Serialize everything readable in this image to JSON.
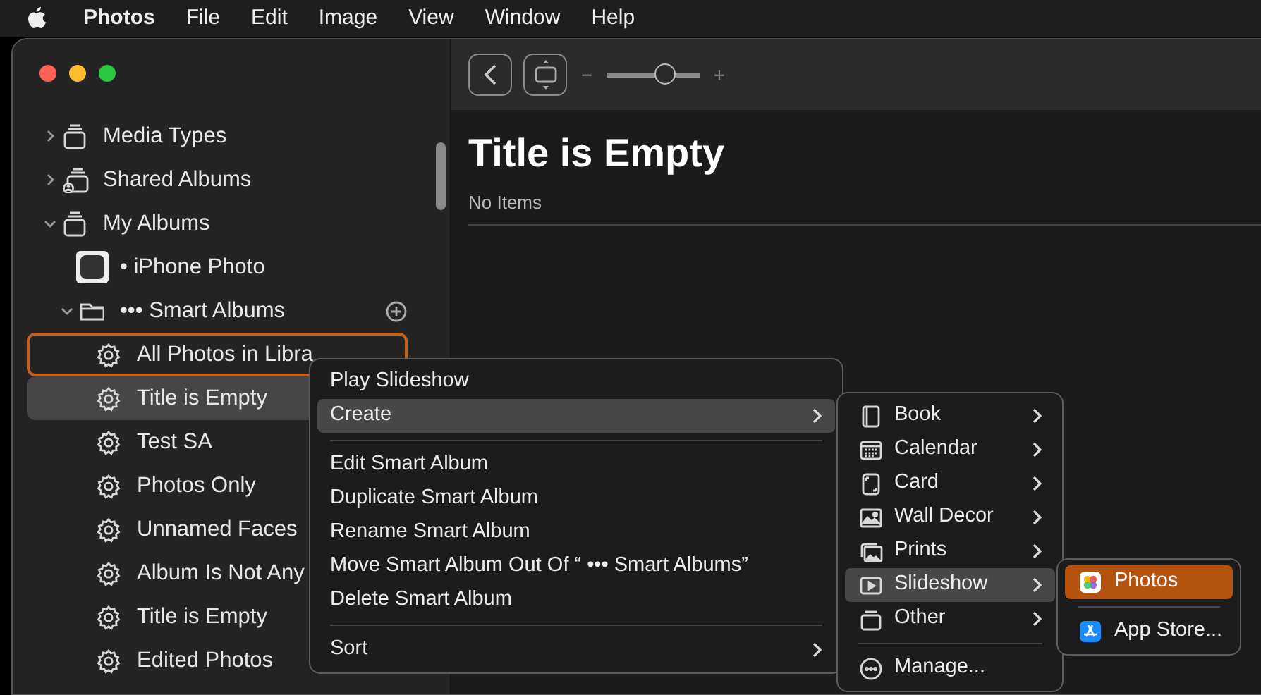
{
  "menu_bar": {
    "items": [
      {
        "label": "Photos",
        "kind": "app"
      },
      {
        "label": "File",
        "kind": "menu"
      },
      {
        "label": "Edit",
        "kind": "menu"
      },
      {
        "label": "Image",
        "kind": "menu"
      },
      {
        "label": "View",
        "kind": "menu"
      },
      {
        "label": "Window",
        "kind": "menu"
      },
      {
        "label": "Help",
        "kind": "menu"
      }
    ]
  },
  "sidebar": {
    "items": [
      {
        "label": "Media Types",
        "kind": "group",
        "expanded": false,
        "selected": false,
        "focused": false
      },
      {
        "label": "Shared Albums",
        "kind": "shared",
        "expanded": false,
        "selected": false,
        "focused": false
      },
      {
        "label": "My Albums",
        "kind": "group",
        "expanded": true,
        "selected": false,
        "focused": false,
        "children": [
          {
            "label": "• iPhone Photo",
            "kind": "album",
            "selected": false,
            "focused": false
          },
          {
            "label": "••• Smart Albums",
            "kind": "folder",
            "expanded": true,
            "selected": false,
            "focused": false,
            "children": [
              {
                "label": "All Photos in Libra",
                "kind": "smart",
                "selected": false,
                "focused": true
              },
              {
                "label": "Title is Empty",
                "kind": "smart",
                "selected": true,
                "focused": false
              },
              {
                "label": "Test SA",
                "kind": "smart",
                "selected": false,
                "focused": false
              },
              {
                "label": "Photos Only",
                "kind": "smart",
                "selected": false,
                "focused": false
              },
              {
                "label": "Unnamed Faces",
                "kind": "smart",
                "selected": false,
                "focused": false
              },
              {
                "label": "Album Is Not Any",
                "kind": "smart",
                "selected": false,
                "focused": false
              },
              {
                "label": "Title is Empty",
                "kind": "smart",
                "selected": false,
                "focused": false
              },
              {
                "label": "Edited Photos",
                "kind": "smart",
                "selected": false,
                "focused": false
              }
            ]
          }
        ]
      }
    ]
  },
  "toolbar": {
    "zoom_slider": {
      "level": 0.62,
      "minus": "−",
      "plus": "+"
    }
  },
  "content": {
    "title": "Title is Empty",
    "subtitle": "No Items"
  },
  "context_menu": {
    "groups": [
      [
        {
          "label": "Play Slideshow",
          "submenu": false,
          "selected": false
        },
        {
          "label": "Create",
          "submenu": true,
          "selected": true
        }
      ],
      [
        {
          "label": "Edit Smart Album",
          "submenu": false,
          "selected": false
        },
        {
          "label": "Duplicate Smart Album",
          "submenu": false,
          "selected": false
        },
        {
          "label": "Rename Smart Album",
          "submenu": false,
          "selected": false
        },
        {
          "label": "Move Smart Album Out Of “ ••• Smart Albums”",
          "submenu": false,
          "selected": false
        },
        {
          "label": "Delete Smart Album",
          "submenu": false,
          "selected": false
        }
      ],
      [
        {
          "label": "Sort",
          "submenu": true,
          "selected": false
        }
      ]
    ]
  },
  "create_submenu": {
    "groups": [
      [
        {
          "label": "Book",
          "submenu": true,
          "selected": false
        },
        {
          "label": "Calendar",
          "submenu": true,
          "selected": false
        },
        {
          "label": "Card",
          "submenu": true,
          "selected": false
        },
        {
          "label": "Wall Decor",
          "submenu": true,
          "selected": false
        },
        {
          "label": "Prints",
          "submenu": true,
          "selected": false
        },
        {
          "label": "Slideshow",
          "submenu": true,
          "selected": true
        },
        {
          "label": "Other",
          "submenu": true,
          "selected": false
        }
      ],
      [
        {
          "label": "Manage...",
          "submenu": false,
          "selected": false
        }
      ]
    ]
  },
  "slideshow_submenu": {
    "groups": [
      [
        {
          "label": "Photos",
          "selected": true
        }
      ],
      [
        {
          "label": "App Store...",
          "selected": false
        }
      ]
    ]
  }
}
